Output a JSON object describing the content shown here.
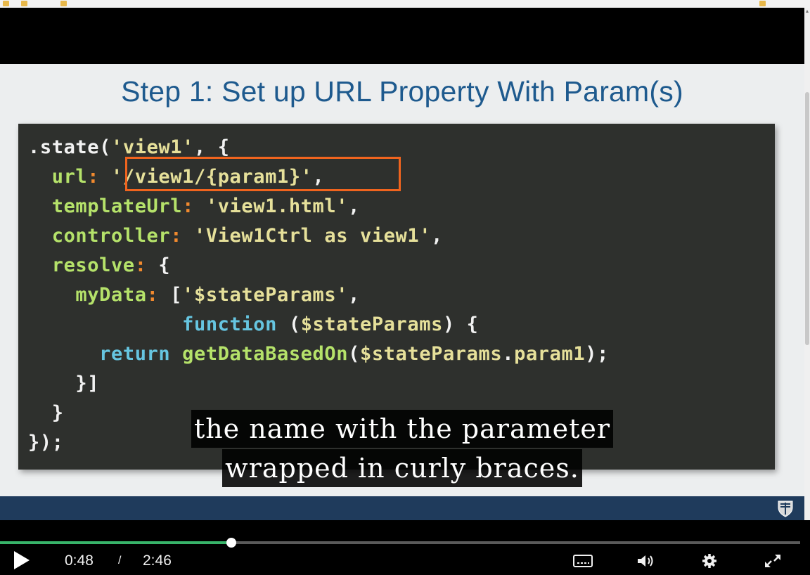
{
  "browser": {
    "bookmarks": [
      "",
      "",
      "",
      "",
      "",
      ""
    ],
    "right_bookmark": ""
  },
  "slide": {
    "title": "Step 1: Set up URL Property With Param(s)",
    "code_lines": [
      [
        {
          "t": ".state(",
          "c": "pu"
        },
        {
          "t": "'view1'",
          "c": "str"
        },
        {
          "t": ", {",
          "c": "pu"
        }
      ],
      [
        {
          "t": "  url",
          "c": "kw"
        },
        {
          "t": ": ",
          "c": "punc"
        },
        {
          "t": "'/view1/{param1}'",
          "c": "str"
        },
        {
          "t": ",",
          "c": "pu"
        }
      ],
      [
        {
          "t": "  templateUrl",
          "c": "kw"
        },
        {
          "t": ": ",
          "c": "punc"
        },
        {
          "t": "'view1.html'",
          "c": "str"
        },
        {
          "t": ",",
          "c": "pu"
        }
      ],
      [
        {
          "t": "  controller",
          "c": "kw"
        },
        {
          "t": ": ",
          "c": "punc"
        },
        {
          "t": "'View1Ctrl as view1'",
          "c": "str"
        },
        {
          "t": ",",
          "c": "pu"
        }
      ],
      [
        {
          "t": "  resolve",
          "c": "kw"
        },
        {
          "t": ": ",
          "c": "punc"
        },
        {
          "t": "{",
          "c": "pu"
        }
      ],
      [
        {
          "t": "    myData",
          "c": "kw"
        },
        {
          "t": ": ",
          "c": "punc"
        },
        {
          "t": "[",
          "c": "pu"
        },
        {
          "t": "'$stateParams'",
          "c": "str"
        },
        {
          "t": ",",
          "c": "pu"
        }
      ],
      [
        {
          "t": "             function",
          "c": "fn"
        },
        {
          "t": " (",
          "c": "pu"
        },
        {
          "t": "$stateParams",
          "c": "str"
        },
        {
          "t": ") {",
          "c": "pu"
        }
      ],
      [
        {
          "t": "      return",
          "c": "fn"
        },
        {
          "t": " ",
          "c": "pu"
        },
        {
          "t": "getDataBasedOn",
          "c": "kw"
        },
        {
          "t": "(",
          "c": "pu"
        },
        {
          "t": "$stateParams",
          "c": "str"
        },
        {
          "t": ".",
          "c": "pu"
        },
        {
          "t": "param1",
          "c": "str"
        },
        {
          "t": ");",
          "c": "pu"
        }
      ],
      [
        {
          "t": "    }]",
          "c": "pu"
        }
      ],
      [
        {
          "t": "  }",
          "c": "pu"
        }
      ],
      [
        {
          "t": "});",
          "c": "pu"
        }
      ]
    ]
  },
  "captions": {
    "line1": "the name with the parameter",
    "line2": "wrapped in curly braces."
  },
  "player": {
    "current_time": "0:48",
    "separator": "/",
    "duration": "2:46",
    "progress_fraction": 0.289,
    "played_color": "#38b46a"
  },
  "colors": {
    "title": "#1e5a8e",
    "highlight_box": "#f0641e",
    "code_bg": "#2e302d",
    "footer": "#1f3b5c"
  }
}
